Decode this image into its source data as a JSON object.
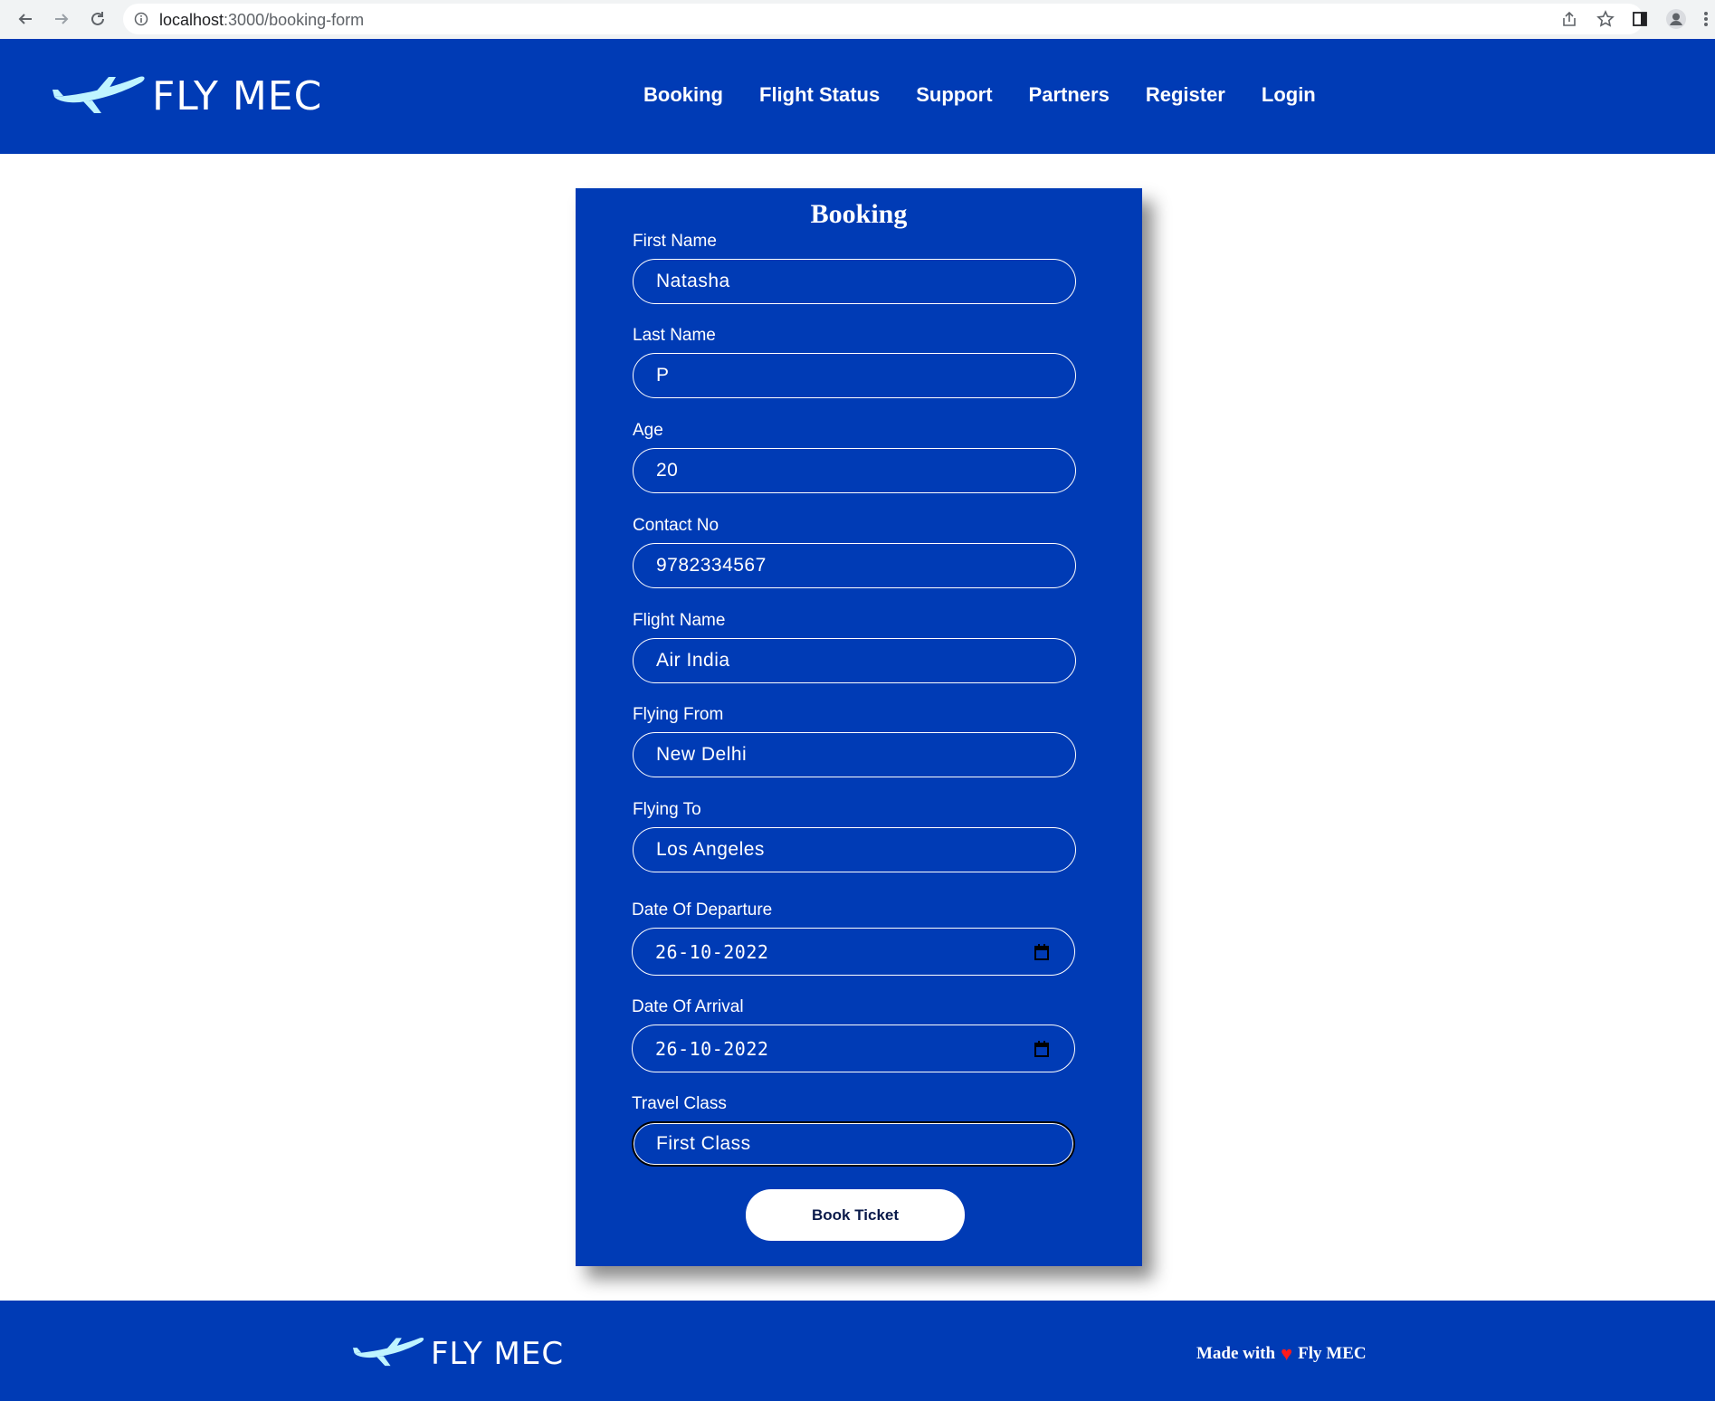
{
  "browser": {
    "url_host": "localhost",
    "url_path": ":3000/booking-form"
  },
  "header": {
    "logo_text": "FLY MEC",
    "nav": [
      "Booking",
      "Flight Status",
      "Support",
      "Partners",
      "Register",
      "Login"
    ]
  },
  "form": {
    "title": "Booking",
    "fields": [
      {
        "label": "First Name",
        "value": "Natasha"
      },
      {
        "label": "Last Name",
        "value": "P"
      },
      {
        "label": "Age",
        "value": "20"
      },
      {
        "label": "Contact No",
        "value": "9782334567"
      },
      {
        "label": "Flight Name",
        "value": "Air India"
      },
      {
        "label": "Flying From",
        "value": "New Delhi"
      },
      {
        "label": "Flying To",
        "value": "Los Angeles"
      },
      {
        "label": "Date Of Departure",
        "value": "26-10-2022"
      },
      {
        "label": "Date Of Arrival",
        "value": "26-10-2022"
      },
      {
        "label": "Travel Class",
        "value": "First Class"
      }
    ],
    "submit_label": "Book Ticket"
  },
  "footer": {
    "logo_text": "FLY MEC",
    "made_with": "Made with",
    "brand": "Fly MEC"
  },
  "colors": {
    "brand_blue": "#003bb5",
    "logo_plane": "#bff4ff",
    "heart": "#ff1a1a"
  }
}
